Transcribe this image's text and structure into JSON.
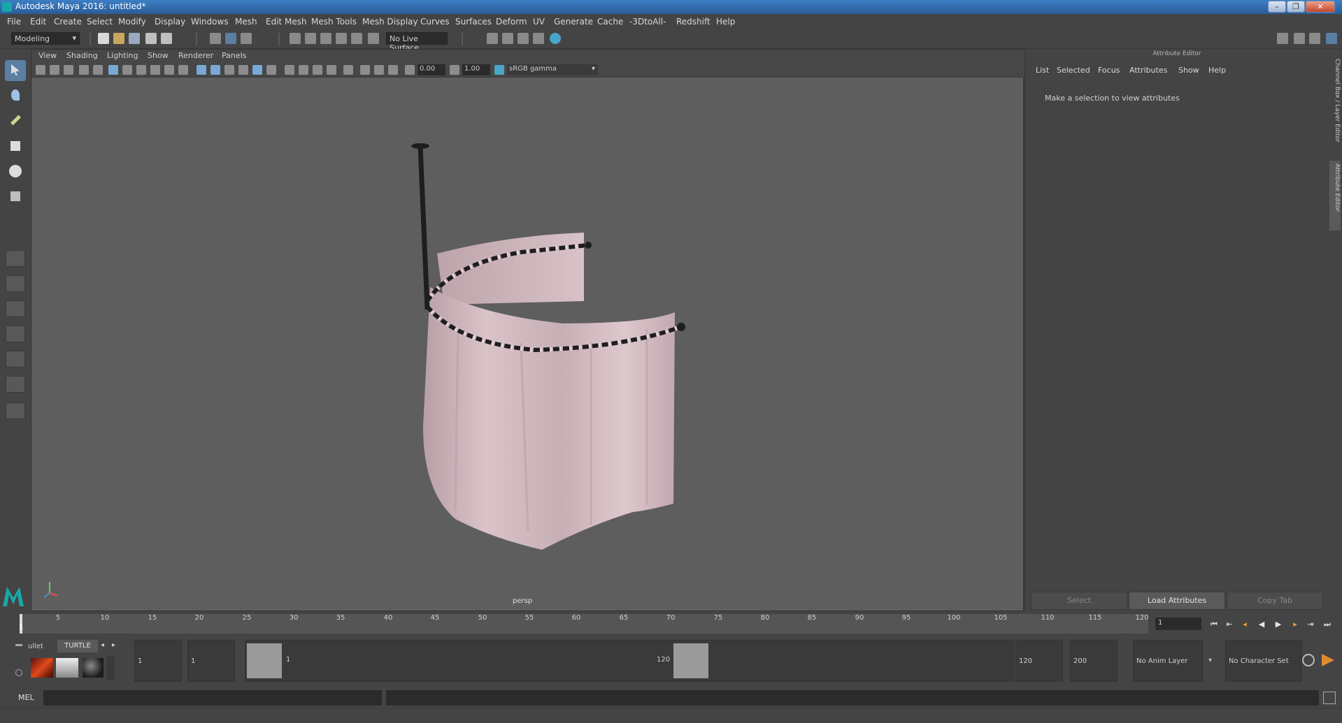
{
  "window": {
    "title": "Autodesk Maya 2016: untitled*"
  },
  "menubar": [
    "File",
    "Edit",
    "Create",
    "Select",
    "Modify",
    "Display",
    "Windows",
    "Mesh",
    "Edit Mesh",
    "Mesh Tools",
    "Mesh Display",
    "Curves",
    "Surfaces",
    "Deform",
    "UV",
    "Generate",
    "Cache",
    "-3DtoAll-",
    "Redshift",
    "Help"
  ],
  "toolbar": {
    "mode": "Modeling",
    "live_surface": "No Live Surface"
  },
  "viewport": {
    "menu": [
      "View",
      "Shading",
      "Lighting",
      "Show",
      "Renderer",
      "Panels"
    ],
    "exposure": "0.00",
    "gamma": "1.00",
    "color_space": "sRGB gamma",
    "camera_label": "persp"
  },
  "attribute_editor": {
    "title": "Attribute Editor",
    "menu": [
      "List",
      "Selected",
      "Focus",
      "Attributes",
      "Show",
      "Help"
    ],
    "message": "Make a selection to view attributes",
    "buttons": {
      "select": "Select",
      "load": "Load Attributes",
      "copy": "Copy Tab"
    }
  },
  "side_tabs": {
    "channel_box": "Channel Box / Layer Editor",
    "attribute_editor": "Attribute Editor"
  },
  "timeline": {
    "ticks": [
      "1",
      "5",
      "10",
      "15",
      "20",
      "25",
      "30",
      "35",
      "40",
      "45",
      "50",
      "55",
      "60",
      "65",
      "70",
      "75",
      "80",
      "85",
      "90",
      "95",
      "100",
      "105",
      "110",
      "115",
      "120"
    ],
    "current_frame": "1"
  },
  "range": {
    "shelf_tabs": [
      "ullet",
      "TURTLE"
    ],
    "start": "1",
    "playback_start": "1",
    "range_start_label": "1",
    "range_end_label": "120",
    "playback_end": "120",
    "end": "200",
    "anim_layer": "No Anim Layer",
    "character_set": "No Character Set"
  },
  "command_line": {
    "language": "MEL"
  }
}
